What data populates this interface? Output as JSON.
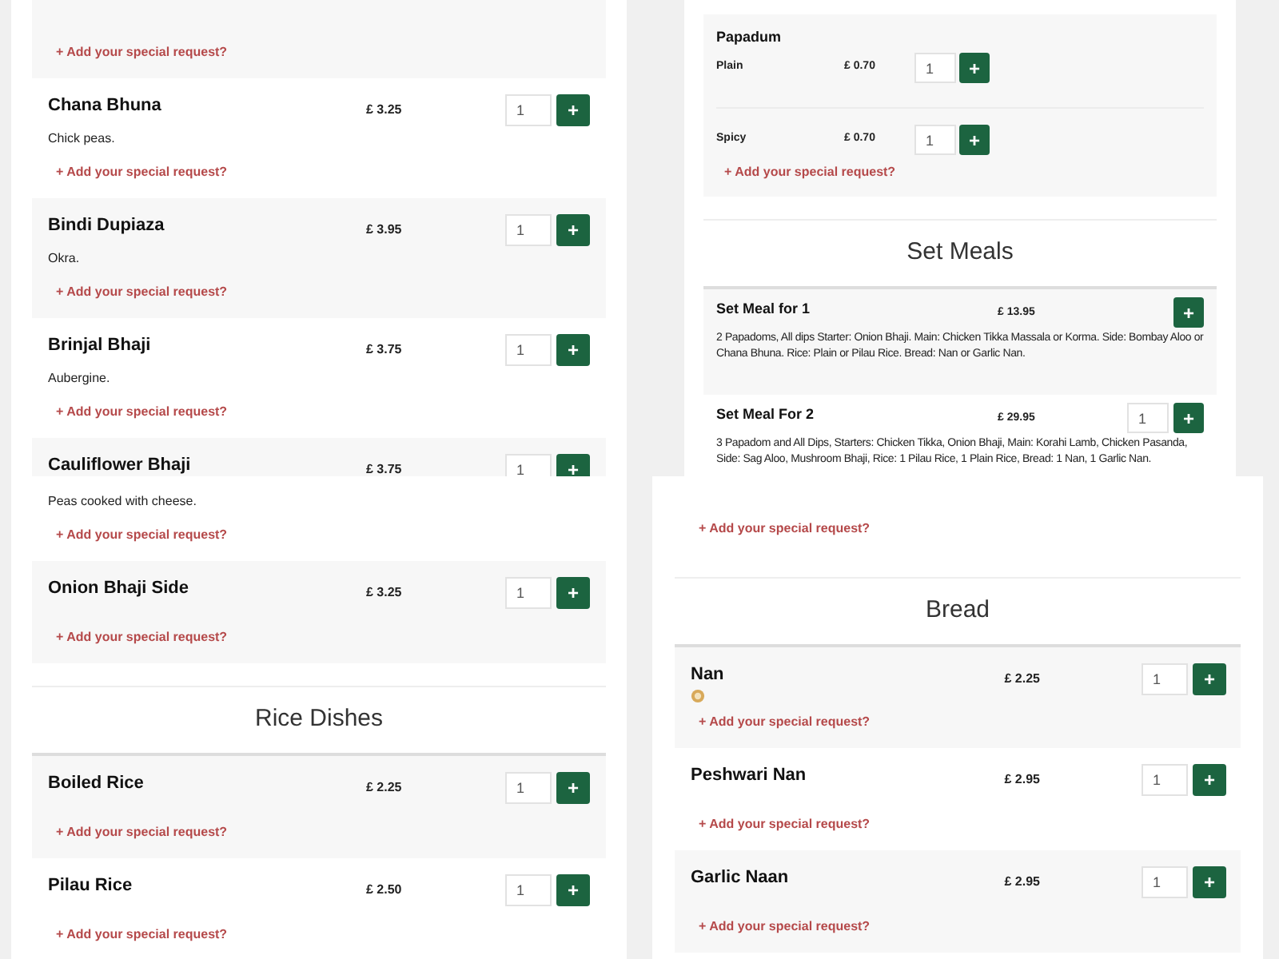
{
  "panels": [
    {
      "blocks": [
        {
          "kind": "tail",
          "request": "+ Add your special request?"
        },
        {
          "kind": "dish",
          "name": "Chana Bhuna",
          "price": "£ 3.25",
          "quantity": "1",
          "add_label": "+",
          "description": "Chick peas.",
          "request": "+ Add your special request?"
        },
        {
          "kind": "dish",
          "name": "Bindi Dupiaza",
          "price": "£ 3.95",
          "quantity": "1",
          "add_label": "+",
          "description": "Okra.",
          "request": "+ Add your special request?"
        },
        {
          "kind": "dish",
          "name": "Brinjal Bhaji",
          "price": "£ 3.75",
          "quantity": "1",
          "add_label": "+",
          "description": "Aubergine.",
          "request": "+ Add your special request?"
        },
        {
          "kind": "dish",
          "name": "Cauliflower Bhaji",
          "price": "£ 3.75",
          "quantity": "1",
          "add_label": "+"
        }
      ]
    },
    {
      "blocks": [
        {
          "kind": "papadum",
          "title": "Papadum",
          "options": [
            {
              "label": "Plain",
              "price": "£ 0.70",
              "quantity": "1",
              "add_label": "+"
            },
            {
              "label": "Spicy",
              "price": "£ 0.70",
              "quantity": "1",
              "add_label": "+"
            }
          ],
          "request": "+ Add your special request?"
        },
        {
          "kind": "heading",
          "title": "Set Meals"
        },
        {
          "kind": "set_meal",
          "name": "Set Meal for 1",
          "price": "£ 13.95",
          "add_label": "+",
          "description": "2 Papadoms, All dips Starter: Onion Bhaji. Main: Chicken Tikka Massala or Korma. Side: Bombay Aloo or Chana Bhuna. Rice: Plain or Pilau Rice. Bread: Nan or Garlic Nan."
        },
        {
          "kind": "set_meal",
          "name": "Set Meal For 2",
          "price": "£ 29.95",
          "quantity": "1",
          "add_label": "+",
          "description": "3 Papadom and All Dips, Starters: Chicken Tikka, Onion Bhaji, Main: Korahi Lamb, Chicken Pasanda, Side: Sag Aloo, Mushroom Bhaji, Rice: 1 Pilau Rice, 1 Plain Rice, Bread: 1 Nan, 1 Garlic Nan."
        }
      ]
    },
    {
      "blocks": [
        {
          "kind": "tail",
          "description": "Peas cooked with cheese.",
          "request": "+ Add your special request?"
        },
        {
          "kind": "dish",
          "name": "Onion Bhaji Side",
          "price": "£ 3.25",
          "quantity": "1",
          "add_label": "+",
          "request": "+ Add your special request?"
        },
        {
          "kind": "heading",
          "title": "Rice Dishes"
        },
        {
          "kind": "dish",
          "name": "Boiled Rice",
          "price": "£ 2.25",
          "quantity": "1",
          "add_label": "+",
          "request": "+ Add your special request?"
        },
        {
          "kind": "dish",
          "name": "Pilau Rice",
          "price": "£ 2.50",
          "quantity": "1",
          "add_label": "+",
          "request": "+ Add your special request?"
        }
      ]
    },
    {
      "blocks": [
        {
          "kind": "tail",
          "request": "+ Add your special request?"
        },
        {
          "kind": "heading",
          "title": "Bread"
        },
        {
          "kind": "dish",
          "name": "Nan",
          "price": "£ 2.25",
          "quantity": "1",
          "add_label": "+",
          "badge": true,
          "request": "+ Add your special request?"
        },
        {
          "kind": "dish",
          "name": "Peshwari Nan",
          "price": "£ 2.95",
          "quantity": "1",
          "add_label": "+",
          "request": "+ Add your special request?"
        },
        {
          "kind": "dish",
          "name": "Garlic Naan",
          "price": "£ 2.95",
          "quantity": "1",
          "add_label": "+",
          "request": "+ Add your special request?"
        }
      ]
    }
  ]
}
